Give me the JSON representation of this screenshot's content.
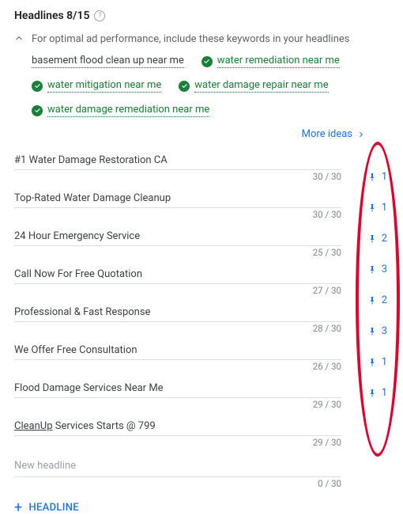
{
  "header": {
    "title": "Headlines 8/15"
  },
  "suggestion": {
    "intro": "For optimal ad performance, include these keywords in your headlines",
    "keywords": [
      {
        "text": "basement flood clean up near me",
        "checked": false
      },
      {
        "text": "water remediation near me",
        "checked": true
      },
      {
        "text": "water mitigation near me",
        "checked": true
      },
      {
        "text": "water damage repair near me",
        "checked": true
      },
      {
        "text": "water damage remediation near me",
        "checked": true
      }
    ],
    "more_ideas_label": "More ideas"
  },
  "headlines": [
    {
      "text": "#1 Water Damage Restoration CA",
      "count": "30 / 30",
      "pin": "1"
    },
    {
      "text": "Top-Rated Water Damage Cleanup",
      "count": "30 / 30",
      "pin": "1"
    },
    {
      "text": "24 Hour Emergency Service",
      "count": "25 / 30",
      "pin": "2"
    },
    {
      "text": "Call Now For Free Quotation",
      "count": "27 / 30",
      "pin": "3"
    },
    {
      "text": "Professional & Fast Response",
      "count": "28 / 30",
      "pin": "2"
    },
    {
      "text": "We Offer Free Consultation",
      "count": "26 / 30",
      "pin": "3"
    },
    {
      "text": "Flood Damage Services Near Me",
      "count": "29 / 30",
      "pin": "1"
    },
    {
      "text_prefix": "CleanUp",
      "text_suffix": " Services Starts @ 799",
      "count": "29 / 30",
      "pin": "1"
    }
  ],
  "new_headline": {
    "placeholder": "New headline",
    "count": "0 / 30"
  },
  "add_button": {
    "label": "HEADLINE"
  }
}
